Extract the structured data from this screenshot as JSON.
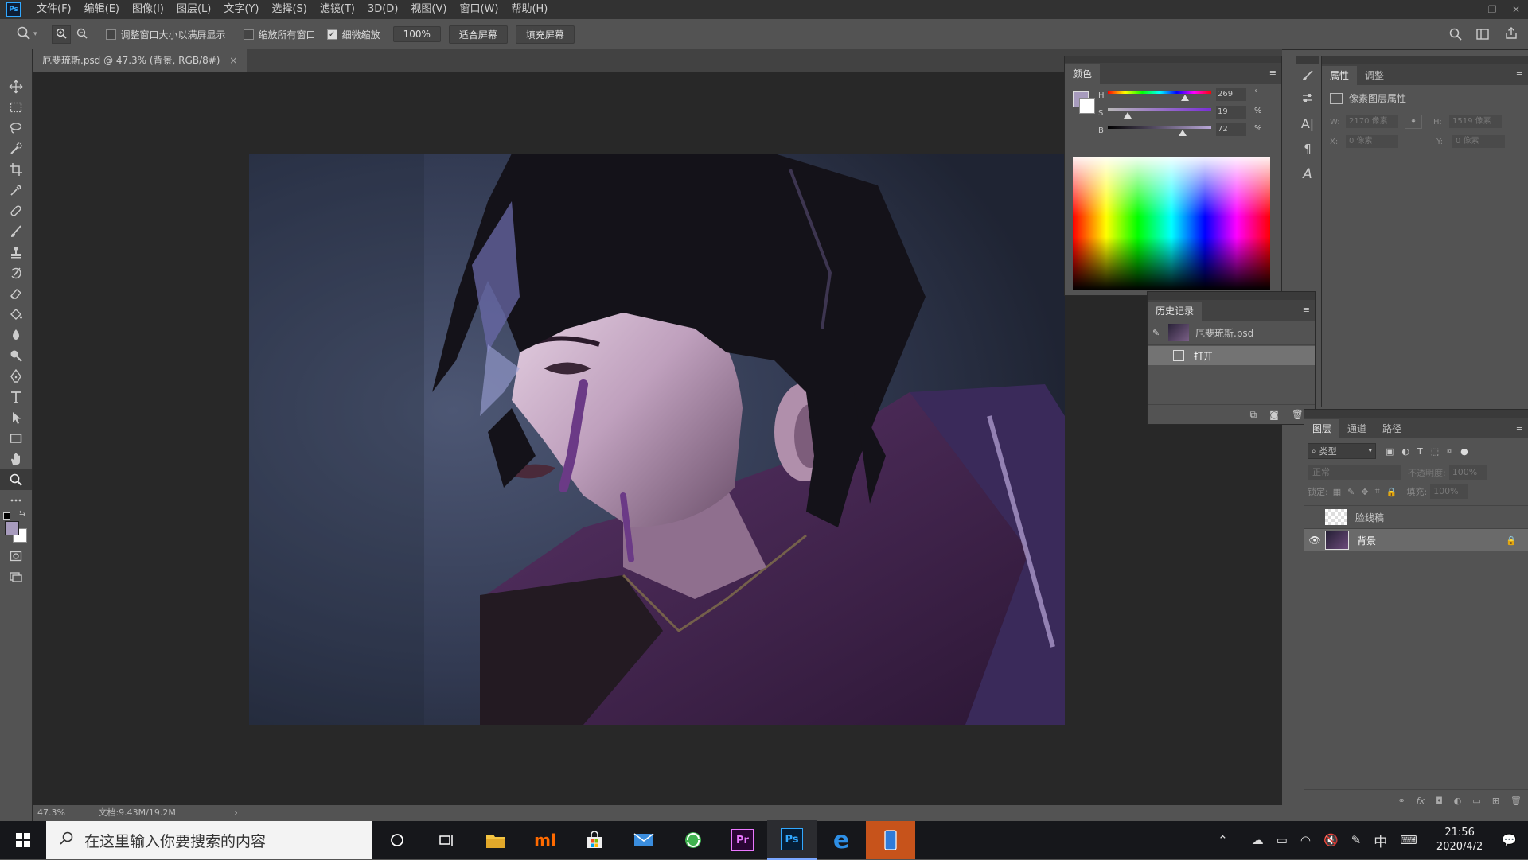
{
  "menubar": {
    "logo": "Ps",
    "items": [
      "文件(F)",
      "编辑(E)",
      "图像(I)",
      "图层(L)",
      "文字(Y)",
      "选择(S)",
      "滤镜(T)",
      "3D(D)",
      "视图(V)",
      "窗口(W)",
      "帮助(H)"
    ]
  },
  "options": {
    "resize_window_label": "调整窗口大小以满屏显示",
    "zoom_all_label": "缩放所有窗口",
    "scrubby_zoom_label": "细微缩放",
    "zoom_value": "100%",
    "fit_screen_label": "适合屏幕",
    "fill_screen_label": "填充屏幕"
  },
  "document": {
    "tab_title": "厄斐琉斯.psd @ 47.3% (背景, RGB/8#)",
    "tab_close": "×",
    "status_zoom": "47.3%",
    "status_doc": "文档:9.43M/19.2M",
    "status_arrow": "›"
  },
  "color_panel": {
    "tab": "颜色",
    "h_label": "H",
    "h_value": "269",
    "h_unit": "°",
    "s_label": "S",
    "s_value": "19",
    "s_unit": "%",
    "b_label": "B",
    "b_value": "72",
    "b_unit": "%",
    "h_fraction": 0.747,
    "s_fraction": 0.19,
    "b_fraction": 0.72,
    "fg_color": "#a79bbd",
    "bg_color": "#ffffff"
  },
  "history_panel": {
    "tab": "历史记录",
    "snapshot_name": "厄斐琉斯.psd",
    "items": [
      "打开"
    ]
  },
  "properties_panel": {
    "tabs": [
      "属性",
      "调整"
    ],
    "type_label": "像素图层属性",
    "w_label": "W:",
    "w_value": "2170 像素",
    "h_label": "H:",
    "h_value": "1519 像素",
    "x_label": "X:",
    "x_value": "0 像素",
    "y_label": "Y:",
    "y_value": "0 像素"
  },
  "layers_panel": {
    "tabs": [
      "图层",
      "通道",
      "路径"
    ],
    "filter_label": "类型",
    "blend_mode": "正常",
    "opacity_label": "不透明度:",
    "opacity_value": "100%",
    "lock_label": "锁定:",
    "fill_label": "填充:",
    "fill_value": "100%",
    "layers": [
      {
        "name": "脸线稿",
        "visible": false,
        "locked": false
      },
      {
        "name": "背景",
        "visible": true,
        "locked": true
      }
    ]
  },
  "taskbar": {
    "search_placeholder": "在这里输入你要搜索的内容",
    "ime": "中",
    "time": "21:56",
    "date": "2020/4/2",
    "apps": [
      "file-explorer",
      "mi",
      "store",
      "mail",
      "browser-360",
      "premiere",
      "photoshop",
      "edge",
      "phone"
    ],
    "pr_label": "Pr",
    "ps_label": "Ps"
  }
}
